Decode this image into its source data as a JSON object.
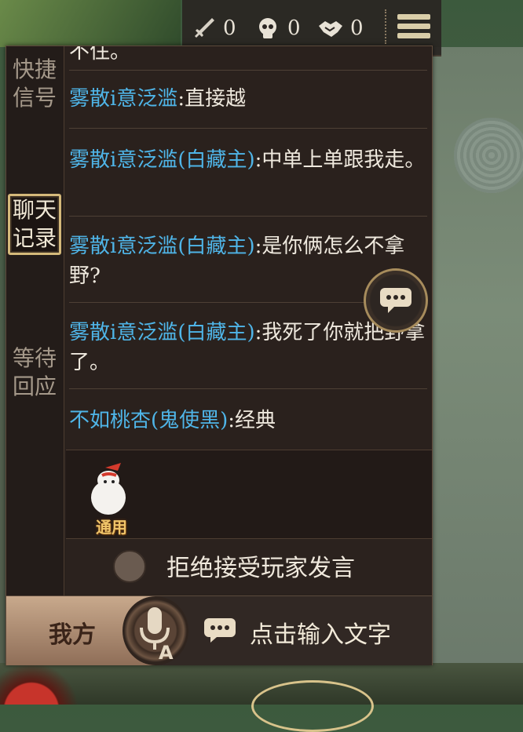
{
  "stats": [
    {
      "icon": "sword-icon",
      "value": "0"
    },
    {
      "icon": "skull-icon",
      "value": "0"
    },
    {
      "icon": "handshake-icon",
      "value": "0"
    }
  ],
  "tabs": [
    {
      "label": "快捷信号",
      "active": false
    },
    {
      "label": "聊天记录",
      "active": true
    },
    {
      "label": "等待回应",
      "active": false
    }
  ],
  "chat": {
    "partial_text": "不住。",
    "messages": [
      {
        "sender": "雾散i意泛滥",
        "text": ":直接越"
      },
      {
        "sender": "雾散i意泛滥(白藏主)",
        "text": ":中单上单跟我走。"
      },
      {
        "sender": "雾散i意泛滥(白藏主)",
        "text": ":是你俩怎么不拿野?"
      },
      {
        "sender": "雾散i意泛滥(白藏主)",
        "text": ":我死了你就把野拿了。"
      },
      {
        "sender": "不如桃杏(鬼使黑)",
        "text": ":经典"
      }
    ]
  },
  "emote": {
    "label": "通用"
  },
  "refuse": {
    "label": "拒绝接受玩家发言",
    "checked": false
  },
  "bottom": {
    "team_label": "我方",
    "input_placeholder": "点击输入文字"
  },
  "colors": {
    "sender_name": "#4fb5e8",
    "accent_gold": "#d4b97a"
  }
}
